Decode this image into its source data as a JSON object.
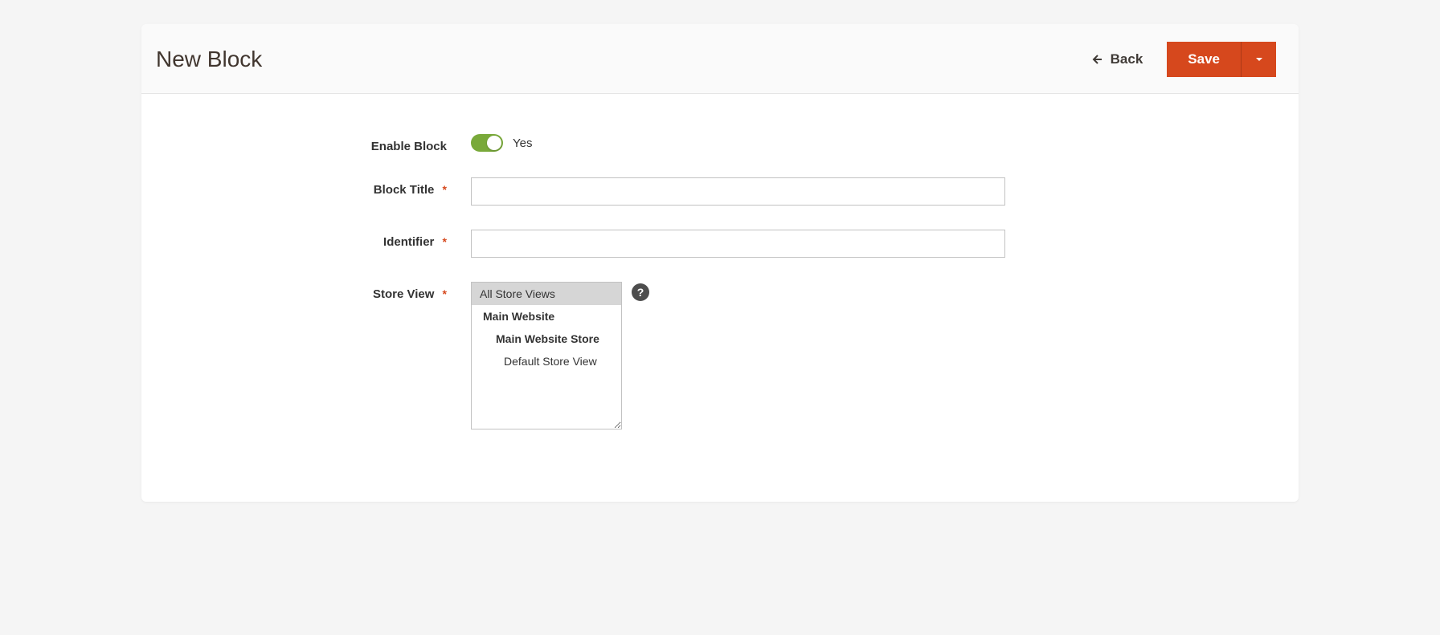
{
  "header": {
    "title": "New Block",
    "back_label": "Back",
    "save_label": "Save"
  },
  "form": {
    "enable_block": {
      "label": "Enable Block",
      "value_label": "Yes"
    },
    "block_title": {
      "label": "Block Title",
      "value": ""
    },
    "identifier": {
      "label": "Identifier",
      "value": ""
    },
    "store_view": {
      "label": "Store View",
      "options": {
        "all": "All Store Views",
        "main_website": "Main Website",
        "main_website_store": "Main Website Store",
        "default_store_view": "Default Store View"
      }
    }
  },
  "required_star": "*",
  "help_icon": "?"
}
